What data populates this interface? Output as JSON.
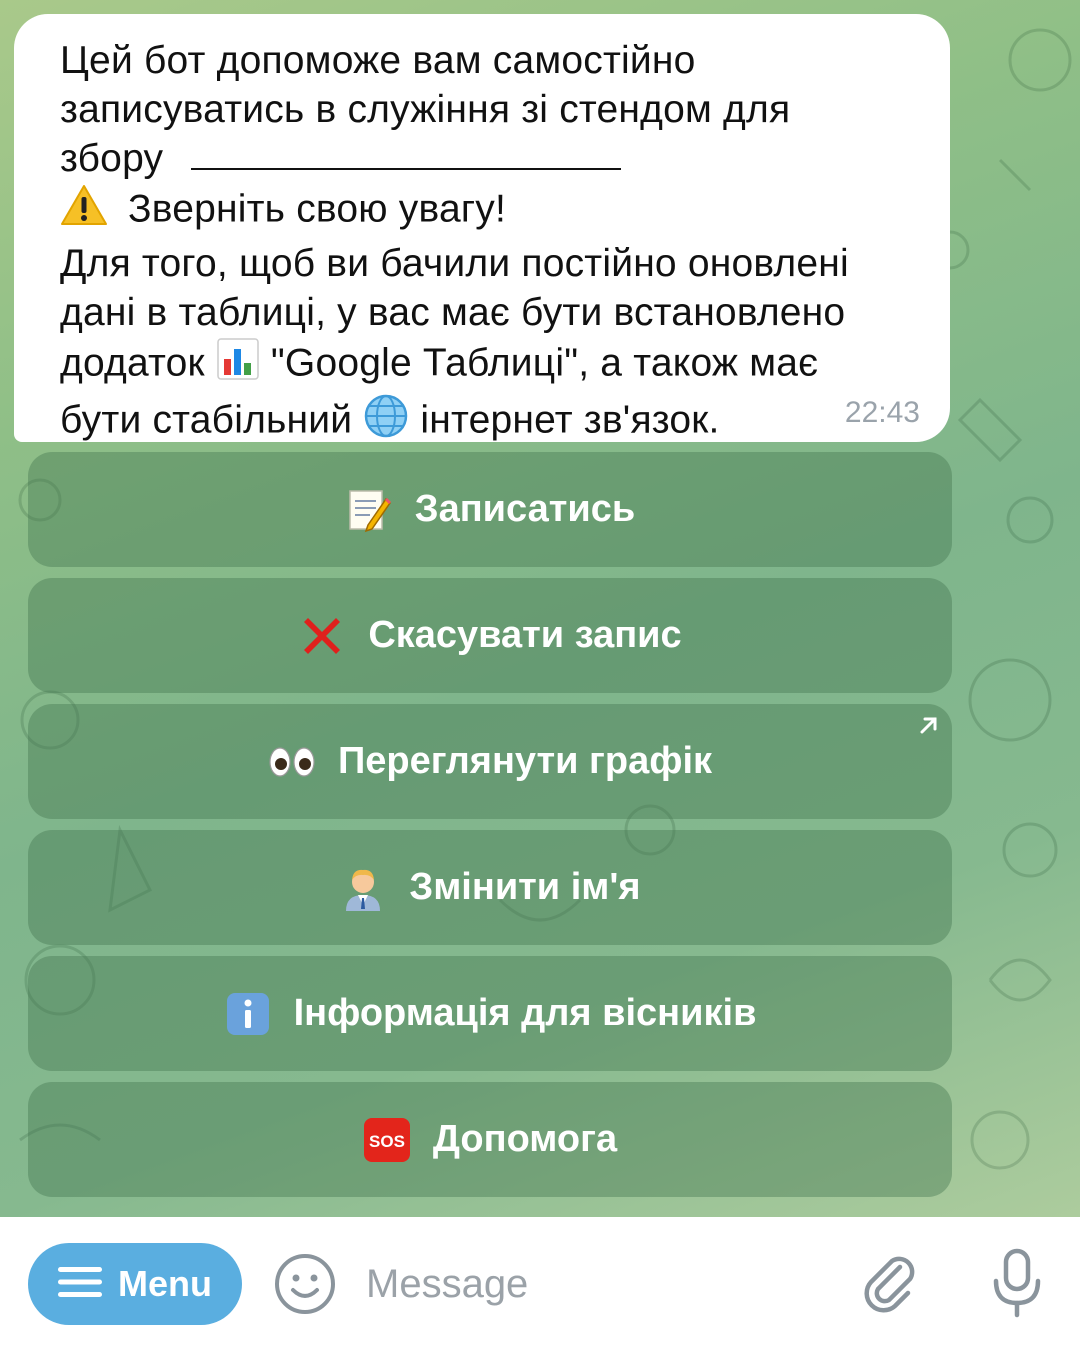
{
  "message": {
    "lines": [
      "Цей бот допоможе вам самостійно",
      "записуватись в служіння зі стендом для",
      "збору",
      "Зверніть свою увагу!",
      "Для того, щоб ви бачили постійно оновлені",
      "дані в таблиці, у вас має бути встановлено",
      "додаток",
      "\"Google Таблиці\", а також має",
      "бути стабільний",
      "інтернет  зв'язок."
    ],
    "time": "22:43"
  },
  "keyboard": {
    "buttons": [
      {
        "label": "Записатись",
        "icon": "memo-icon"
      },
      {
        "label": "Скасувати запис",
        "icon": "cross-mark-icon"
      },
      {
        "label": "Переглянути графік",
        "icon": "eyes-icon",
        "has_link_arrow": true
      },
      {
        "label": "Змінити ім'я",
        "icon": "office-worker-icon"
      },
      {
        "label": "Інформація для вісників",
        "icon": "information-icon"
      },
      {
        "label": "Допомога",
        "icon": "sos-icon"
      }
    ]
  },
  "input_bar": {
    "menu_label": "Menu",
    "placeholder": "Message"
  },
  "colors": {
    "menu_button": "#5aaee0",
    "keyboard_button": "rgba(70,120,80,0.42)",
    "bubble": "#ffffff"
  }
}
